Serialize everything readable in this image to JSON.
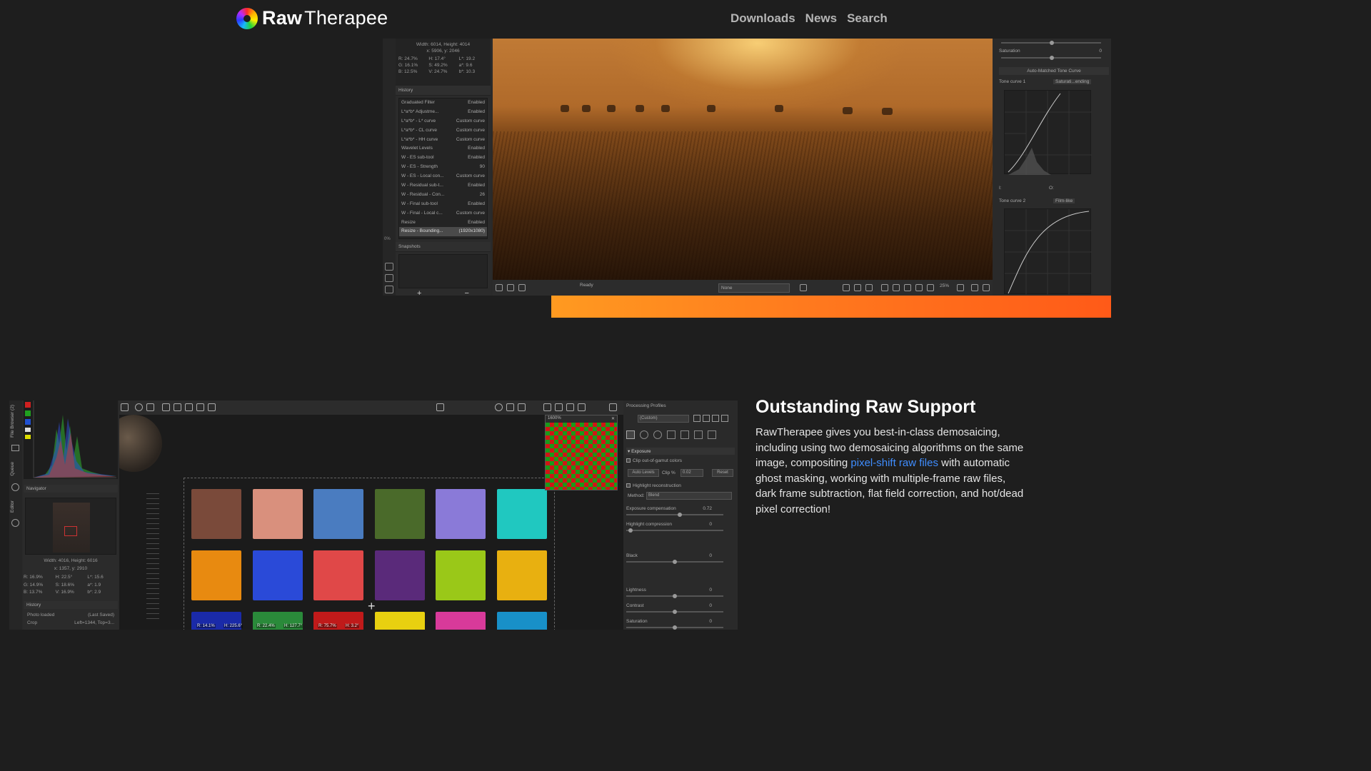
{
  "header": {
    "logo_bold": "Raw",
    "logo_rest": "Therapee",
    "nav": [
      "Downloads",
      "News",
      "Search"
    ]
  },
  "shot1": {
    "info": {
      "size": "Width: 6014, Height: 4014",
      "coords": "x: 5906, y: 2046",
      "rows": [
        [
          "R:",
          "24.7%",
          "H:",
          "17.4°",
          "L*:",
          "19.2"
        ],
        [
          "G:",
          "16.1%",
          "S:",
          "49.2%",
          "a*:",
          "9.6"
        ],
        [
          "B:",
          "12.5%",
          "V:",
          "24.7%",
          "b*:",
          "10.3"
        ]
      ]
    },
    "history_title": "History",
    "history": [
      [
        "Graduated Filter",
        "Enabled"
      ],
      [
        "L*a*b* Adjustme...",
        "Enabled"
      ],
      [
        "L*a*b* - L* curve",
        "Custom curve"
      ],
      [
        "L*a*b* - CL curve",
        "Custom curve"
      ],
      [
        "L*a*b* - HH curve",
        "Custom curve"
      ],
      [
        "Wavelet Levels",
        "Enabled"
      ],
      [
        "W - ES sub-tool",
        "Enabled"
      ],
      [
        "W - ES - Strength",
        "90"
      ],
      [
        "W - ES - Local con...",
        "Custom curve"
      ],
      [
        "W - Residual sub-t...",
        "Enabled"
      ],
      [
        "W - Residual - Con...",
        "26"
      ],
      [
        "W - Final sub-tool",
        "Enabled"
      ],
      [
        "W - Final - Local c...",
        "Custom curve"
      ],
      [
        "Resize",
        "Enabled"
      ],
      [
        "Resize - Bounding...",
        "(1920x1080)"
      ]
    ],
    "snapshots_title": "Snapshots",
    "zoom_label": "0%",
    "status": "Ready",
    "preview_select": "None",
    "zoom_pct": "25%",
    "right": {
      "saturation_label": "Saturation",
      "saturation_value": "0",
      "auto_matched": "Auto-Matched Tone Curve",
      "tone_curve_1": "Tone curve 1",
      "tone_curve_1_mode": "Saturati...ending",
      "tone_curve_2": "Tone curve 2",
      "tone_curve_2_mode": "Film-like",
      "io_i": "I:",
      "io_o": "O:"
    }
  },
  "shot2": {
    "vtabs": [
      "File Browser (2)",
      "Queue",
      "Editor"
    ],
    "navigator_title": "Navigator",
    "nav_info": {
      "size": "Width: 4016, Height: 6016",
      "coords": "x: 1357, y: 2910",
      "rows": [
        [
          "R:",
          "16.9%",
          "H:",
          "22.5°",
          "L*:",
          "15.6"
        ],
        [
          "G:",
          "14.9%",
          "S:",
          "18.6%",
          "a*:",
          "1.9"
        ],
        [
          "B:",
          "13.7%",
          "V:",
          "16.9%",
          "b*:",
          "2.9"
        ]
      ]
    },
    "history_title": "History",
    "history": [
      [
        "Photo loaded",
        "(Last Saved)"
      ],
      [
        "Crop",
        "Left=1344, Top=3..."
      ]
    ],
    "zoom_level": "1600%",
    "patch_labels": [
      "R: 14.1%",
      "H: 225.6°",
      "R: 22.4%",
      "H: 127.7°",
      "R: 75.7%",
      "H: 3.2°"
    ],
    "right": {
      "processing_profiles": "Processing Profiles",
      "profile_value": "(Custom)",
      "exposure": "Exposure",
      "clip_gamut": "Clip out-of-gamut colors",
      "auto_levels": "Auto Levels",
      "clip_pct_label": "Clip %",
      "clip_pct_value": "0.02",
      "reset": "Reset",
      "highlight_recon": "Highlight reconstruction",
      "method_label": "Method:",
      "method_value": "Blend",
      "exp_comp_label": "Exposure compensation",
      "exp_comp_value": "0.72",
      "hl_comp_label": "Highlight compression",
      "hl_comp_value": "0",
      "black_label": "Black",
      "black_value": "0",
      "lightness_label": "Lightness",
      "lightness_value": "0",
      "contrast_label": "Contrast",
      "contrast_value": "0",
      "saturation_label": "Saturation",
      "saturation_value": "0"
    }
  },
  "feature": {
    "title": "Outstanding Raw Support",
    "text_before": "RawTherapee gives you best-in-class demosaicing, including using two demosaicing algorithms on the same image, compositing ",
    "link": "pixel-shift raw files",
    "text_after": " with automatic ghost masking, working with multiple-frame raw files, dark frame subtraction, flat field correction, and hot/dead pixel correction!"
  },
  "colors": {
    "background": "#1e1e1e",
    "accent_orange": "#ff7a1e",
    "link_blue": "#3f8dff"
  },
  "color_checker": [
    "#7a4a3a",
    "#d9907d",
    "#4a7cc0",
    "#4a6a2a",
    "#8a7ad8",
    "#20c8c0",
    "#e88a10",
    "#2a4ad8",
    "#e04848",
    "#5a2a7a",
    "#9ac818",
    "#e8b010",
    "#1a2aa8",
    "#2a8a3a",
    "#c01a1a",
    "#e8d010",
    "#d83a9a",
    "#1890c8"
  ]
}
